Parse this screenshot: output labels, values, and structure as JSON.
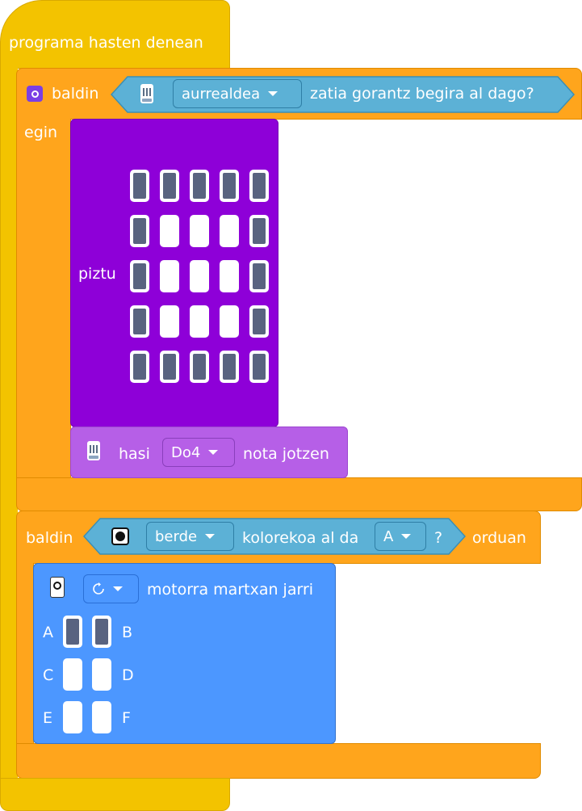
{
  "hat": {
    "label": "programa hasten denean"
  },
  "if1": {
    "keyword": "baldin",
    "do": "egin",
    "sensor_dropdown": "aurrealdea",
    "question": "zatia gorantz begira al dago?"
  },
  "show_leds": {
    "label": "piztu",
    "grid": [
      [
        1,
        1,
        1,
        1,
        1
      ],
      [
        1,
        0,
        0,
        0,
        1
      ],
      [
        1,
        0,
        0,
        0,
        1
      ],
      [
        1,
        0,
        0,
        0,
        1
      ],
      [
        1,
        1,
        1,
        1,
        1
      ]
    ]
  },
  "play_note": {
    "label_start": "hasi",
    "note": "Do4",
    "label_end": "nota jotzen"
  },
  "if2": {
    "keyword": "baldin",
    "color_dropdown": "berde",
    "middle": "kolorekoa al da",
    "port_dropdown": "A",
    "question_mark": "?",
    "then": "orduan"
  },
  "motor": {
    "direction_icon": "rotate-clockwise-icon",
    "label": "motorra martxan jarri",
    "ports": [
      {
        "left": "A",
        "right": "B",
        "left_on": true,
        "right_on": true
      },
      {
        "left": "C",
        "right": "D",
        "left_on": false,
        "right_on": false
      },
      {
        "left": "E",
        "right": "F",
        "left_on": false,
        "right_on": false
      }
    ]
  },
  "colors": {
    "event": "#f3c300",
    "control": "#ffa51c",
    "looks": "#8e00d8",
    "sound": "#b65fe7",
    "sensing": "#5cb1d6",
    "motion": "#4c97ff"
  }
}
